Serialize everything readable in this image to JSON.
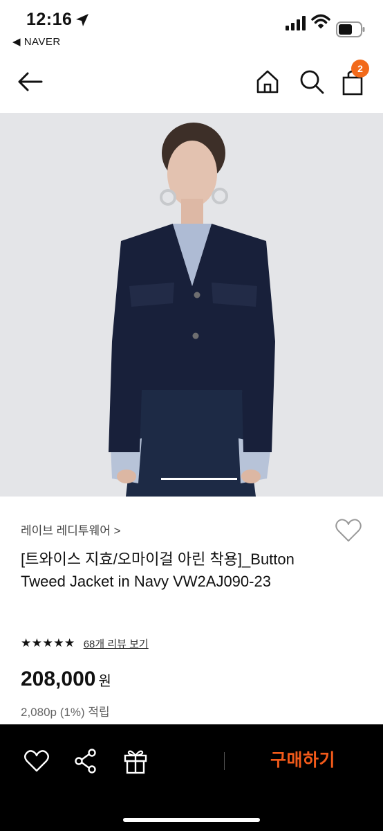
{
  "status": {
    "time": "12:16",
    "back_app": "◀ NAVER",
    "battery_color": "#111111"
  },
  "nav": {
    "cart_count": "2",
    "accent": "#f26a1b"
  },
  "product": {
    "brand": "레이브 레디투웨어 >",
    "title": "[트와이스 지효/오마이걸 아린 착용]_Button Tweed Jacket in Navy VW2AJ090-23",
    "stars": "★★★★★",
    "rating": 5,
    "review_link": "68개 리뷰 보기",
    "price": "208,000",
    "currency": "원",
    "points": "2,080p (1%) 적립"
  },
  "bottom_bar": {
    "buy_label": "구매하기",
    "buy_color": "#f25a1a"
  },
  "icons": [
    "location-arrow-icon",
    "signal-icon",
    "wifi-icon",
    "battery-icon",
    "back-arrow-icon",
    "home-icon",
    "search-icon",
    "cart-icon",
    "heart-icon",
    "share-icon",
    "gift-icon"
  ]
}
